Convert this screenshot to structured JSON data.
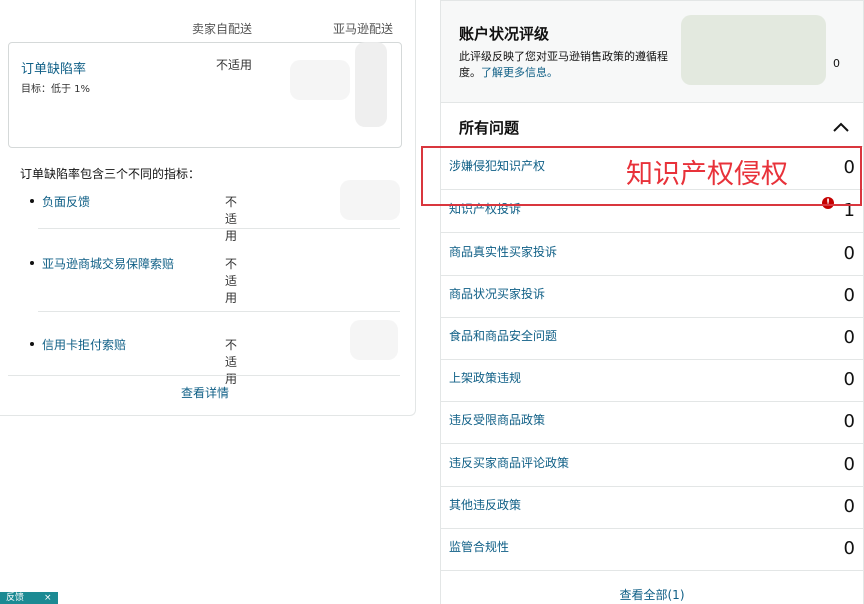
{
  "odr": {
    "col_seller": "卖家自配送",
    "col_amazon": "亚马逊配送",
    "title": "订单缺陷率",
    "target": "目标：低于 1%",
    "value": "不适用",
    "intro": "订单缺陷率包含三个不同的指标：",
    "metrics": [
      {
        "label": "负面反馈",
        "value": "不适用"
      },
      {
        "label": "亚马逊商城交易保障索赔",
        "value": "不适用"
      },
      {
        "label": "信用卡拒付索赔",
        "value": "不适用"
      }
    ],
    "view_details": "查看详情"
  },
  "rating": {
    "title": "账户状况评级",
    "desc_text": "此评级反映了您对亚马逊销售政策的遵循程度。",
    "desc_link": "了解更多信息。",
    "value": "0"
  },
  "issues": {
    "title": "所有问题",
    "items": [
      {
        "label": "涉嫌侵犯知识产权",
        "count": "0"
      },
      {
        "label": "知识产权投诉",
        "count": "1",
        "alert": "!"
      },
      {
        "label": "商品真实性买家投诉",
        "count": "0"
      },
      {
        "label": "商品状况买家投诉",
        "count": "0"
      },
      {
        "label": "食品和商品安全问题",
        "count": "0"
      },
      {
        "label": "上架政策违规",
        "count": "0"
      },
      {
        "label": "违反受限商品政策",
        "count": "0"
      },
      {
        "label": "违反买家商品评论政策",
        "count": "0"
      },
      {
        "label": "其他违反政策",
        "count": "0"
      },
      {
        "label": "监管合规性",
        "count": "0"
      }
    ],
    "view_all": "查看全部(1)"
  },
  "annotation": "知识产权侵权",
  "feedback": "反馈",
  "feedback_close": "×",
  "colors": {
    "link": "#0f5f86",
    "annotation": "#e8323a",
    "alert": "#c40000"
  }
}
